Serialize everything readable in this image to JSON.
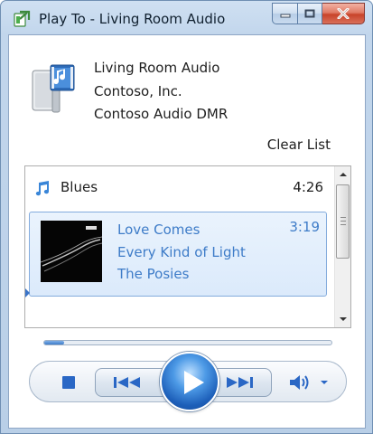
{
  "window": {
    "title": "Play To - Living Room Audio",
    "accent": "#3e7cc8",
    "close_color": "#c8432a"
  },
  "device": {
    "name": "Living Room Audio",
    "manufacturer": "Contoso, Inc.",
    "model": "Contoso Audio DMR",
    "icon": "audio-device-icon"
  },
  "actions": {
    "clear_list": "Clear List"
  },
  "playlist": {
    "title": "Blues",
    "duration": "4:26",
    "items": [
      {
        "title": "Love Comes",
        "album": "Every Kind of Light",
        "artist": "The Posies",
        "duration": "3:19",
        "selected": true
      }
    ]
  },
  "playback": {
    "progress": 0.07,
    "controls": [
      "stop",
      "previous",
      "play",
      "next",
      "volume"
    ]
  }
}
